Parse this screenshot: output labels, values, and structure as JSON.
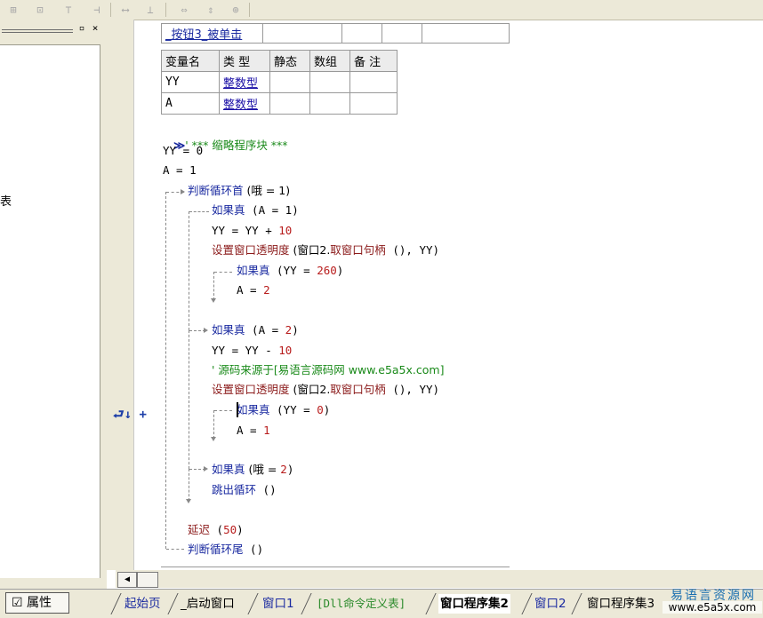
{
  "toolbar": {
    "icons": [
      "align-left-icon",
      "align-center-icon",
      "align-top-icon",
      "align-right-icon",
      "spacing-h-icon",
      "spacing-v-icon",
      "size-width-icon",
      "size-height-icon",
      "size-both-icon"
    ]
  },
  "left_panel": {
    "props_label": "属性",
    "partial_text": "表"
  },
  "sub_header": {
    "name": "_按钮3_被单击"
  },
  "var_table": {
    "headers": [
      "变量名",
      "类 型",
      "静态",
      "数组",
      "备 注"
    ],
    "rows": [
      {
        "name": "YY",
        "type": "整数型"
      },
      {
        "name": "A",
        "type": "整数型"
      }
    ]
  },
  "code": {
    "line1_marker": "≫",
    "line1_comment": "' *** 缩略程序块 ***",
    "l2": "YY = 0",
    "l3": "A = 1",
    "l4_kw": "判断循环首",
    "l4_rest": " (哦 = 1)",
    "l5_kw": "如果真",
    "l5_rest": " (A = 1)",
    "l6_a": "YY = YY + ",
    "l6_b": "10",
    "l7_fn": "设置窗口透明度",
    "l7_a": " (窗口2.",
    "l7_fn2": "取窗口句柄",
    "l7_b": " (), YY)",
    "l8_kw": "如果真",
    "l8_a": " (YY = ",
    "l8_b": "260",
    "l8_c": ")",
    "l9_a": "A = ",
    "l9_b": "2",
    "l10_kw": "如果真",
    "l10_a": " (A = ",
    "l10_b": "2",
    "l10_c": ")",
    "l11_a": "YY = YY - ",
    "l11_b": "10",
    "l12_comment": "' 源码来源于[易语言源码网 www.e5a5x.com]",
    "l13_fn": "设置窗口透明度",
    "l13_a": " (窗口2.",
    "l13_fn2": "取窗口句柄",
    "l13_b": " (), YY)",
    "l14_kw": "如果真",
    "l14_a": " (YY = ",
    "l14_b": "0",
    "l14_c": ")",
    "l15_a": "A = ",
    "l15_b": "1",
    "l16_kw": "如果真",
    "l16_a": " (哦 = ",
    "l16_b": "2",
    "l16_c": ")",
    "l17_kw": "跳出循环",
    "l17_rest": " ()",
    "l18_kw": "延迟",
    "l18_a": " (",
    "l18_b": "50",
    "l18_c": ")",
    "l19_kw": "判断循环尾",
    "l19_rest": " ()"
  },
  "gutter": {
    "marker": "⮐↓ +"
  },
  "tabs": [
    {
      "label": "起始页",
      "active": false,
      "color": "#1a2aa0"
    },
    {
      "label": "_启动窗口",
      "active": false,
      "color": "#000000"
    },
    {
      "label": "窗口1",
      "active": false,
      "color": "#1a2aa0"
    },
    {
      "label": "[Dll命令定义表]",
      "active": false,
      "color": "#2a8a2a"
    },
    {
      "label": "窗口程序集2",
      "active": true,
      "color": "#000000"
    },
    {
      "label": "窗口2",
      "active": false,
      "color": "#1a2aa0"
    },
    {
      "label": "窗口程序集3",
      "active": false,
      "color": "#000000"
    }
  ],
  "watermark": {
    "line1": "易语言资源网",
    "line2": "www.e5a5x.com"
  }
}
